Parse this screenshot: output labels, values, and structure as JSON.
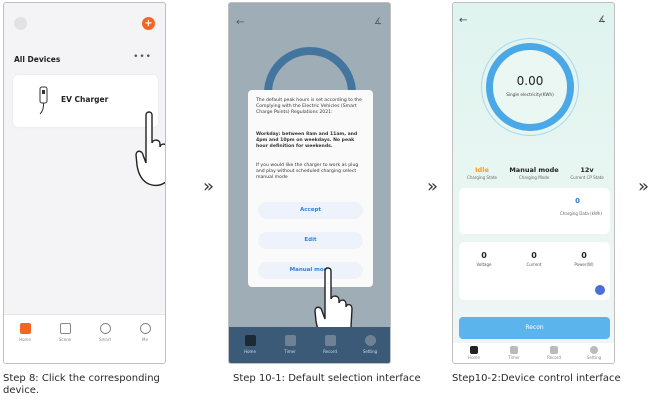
{
  "steps": [
    {
      "caption_line1": "Step 8: Click the corresponding",
      "caption_line2": "device."
    },
    {
      "caption": "Step 10-1: Default selection interface"
    },
    {
      "caption": "Step10-2:Device control interface"
    }
  ],
  "arrow": "»",
  "screen1": {
    "section_title": "All Devices",
    "more": "•••",
    "device_name": "EV Charger",
    "nav": [
      "Home",
      "Scene",
      "Smart",
      "Me"
    ],
    "colors": {
      "accent": "#f26522"
    }
  },
  "screen2": {
    "dialog_text_1": "The default peak hours is set according to the Complying with the Electric Vehicles (Smart Charge Points) Regulations 2021:",
    "dialog_text_2": "Workday: between 8am and 11am, and 4pm and 10pm on weekdays. No peak hour definition for weekends.",
    "dialog_text_3": "If you would like the charger to work as plug and play without scheduled charging select manual mode",
    "buttons": [
      "Accept",
      "Edit",
      "Manual mode"
    ],
    "nav": [
      "Home",
      "Timer",
      "Record",
      "Setting"
    ]
  },
  "screen3": {
    "energy_value": "0.00",
    "energy_label": "Single electricity(KWh)",
    "status": [
      {
        "value": "Idle",
        "label": "Charging State"
      },
      {
        "value": "Manual mode",
        "label": "Charging Mode"
      },
      {
        "value": "12v",
        "label": "Current CP State"
      }
    ],
    "charging_data_value": "0",
    "charging_data_label": "Charging Data (kWh)",
    "measurements": [
      {
        "value": "0",
        "label": "Voltage"
      },
      {
        "value": "0",
        "label": "Current"
      },
      {
        "value": "0",
        "label": "Power(W)"
      }
    ],
    "button_label": "Recon",
    "nav": [
      "Home",
      "Timer",
      "Record",
      "Setting"
    ],
    "colors": {
      "ring": "#4aa8e6",
      "status_idle": "#f0a020"
    }
  }
}
